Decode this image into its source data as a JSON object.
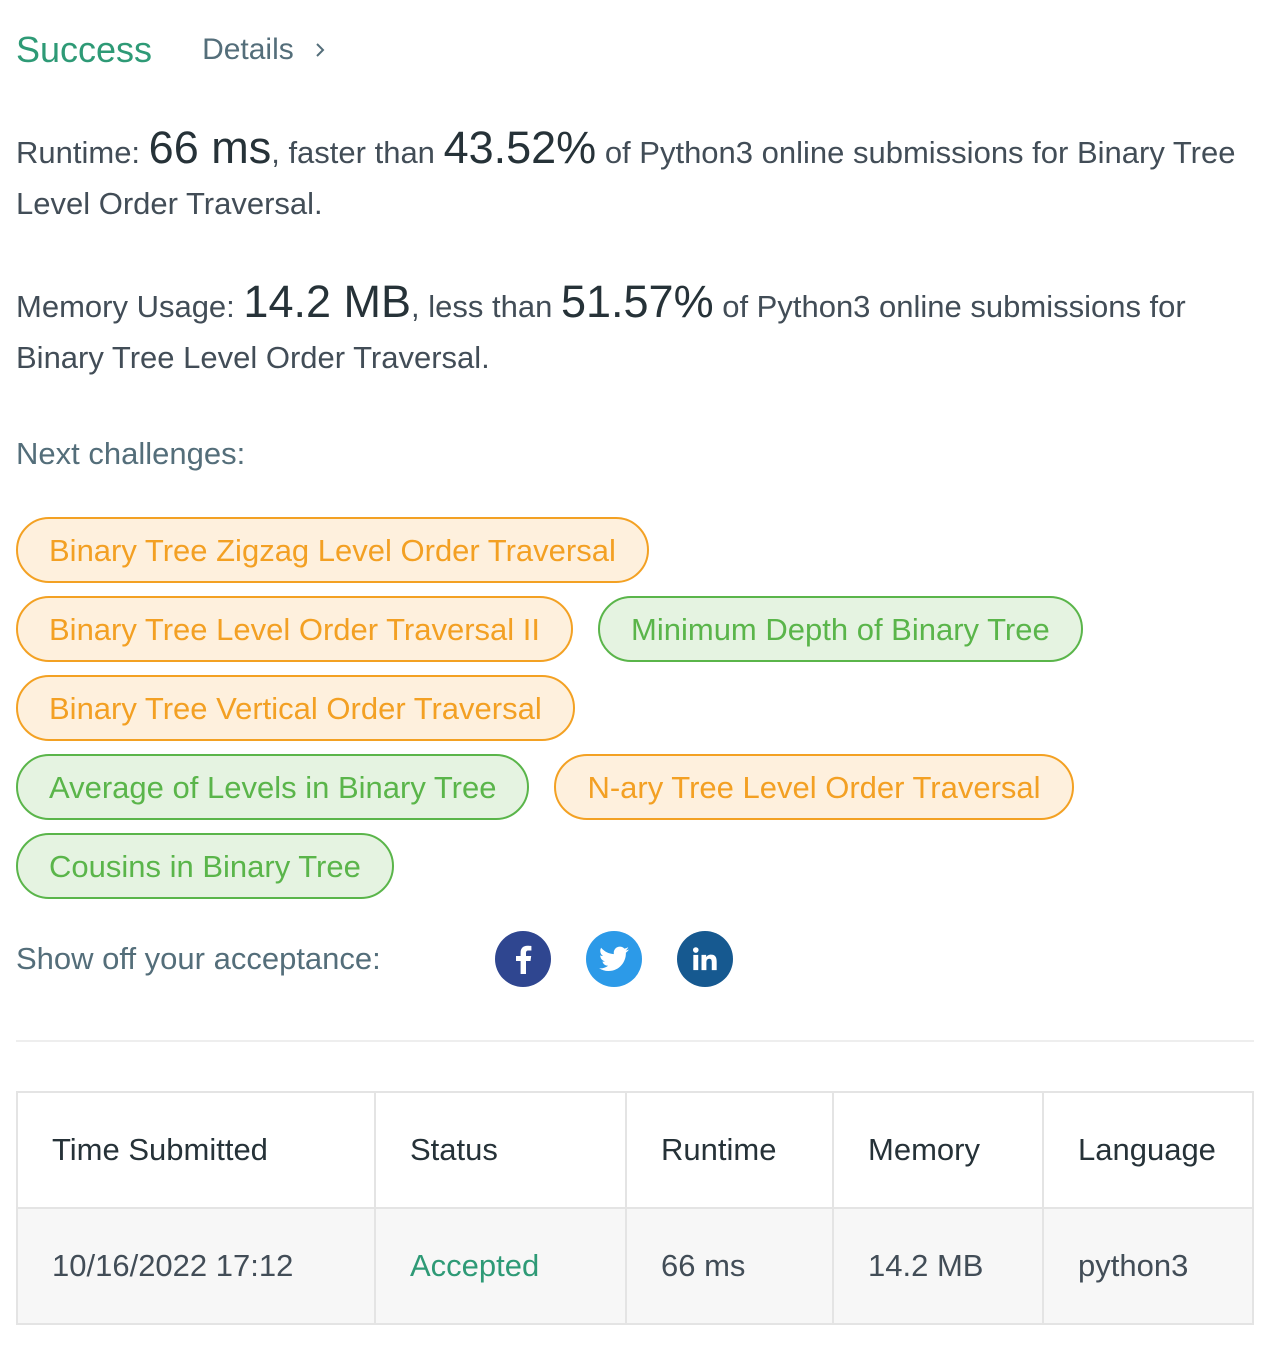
{
  "header": {
    "status": "Success",
    "details_label": "Details"
  },
  "runtime_stat": {
    "label": "Runtime:",
    "value": "66 ms",
    "mid_text": ", faster than",
    "percent": "43.52%",
    "tail_text": "of Python3 online submissions for Binary Tree Level Order Traversal."
  },
  "memory_stat": {
    "label": "Memory Usage:",
    "value": "14.2 MB",
    "mid_text": ", less than",
    "percent": "51.57%",
    "tail_text": "of Python3 online submissions for Binary Tree Level Order Traversal."
  },
  "next_challenges": {
    "label": "Next challenges:",
    "rows": [
      [
        {
          "title": "Binary Tree Zigzag Level Order Traversal",
          "difficulty": "medium"
        }
      ],
      [
        {
          "title": "Binary Tree Level Order Traversal II",
          "difficulty": "medium"
        },
        {
          "title": "Minimum Depth of Binary Tree",
          "difficulty": "easy"
        }
      ],
      [
        {
          "title": "Binary Tree Vertical Order Traversal",
          "difficulty": "medium"
        }
      ],
      [
        {
          "title": "Average of Levels in Binary Tree",
          "difficulty": "easy"
        },
        {
          "title": "N-ary Tree Level Order Traversal",
          "difficulty": "medium"
        }
      ],
      [
        {
          "title": "Cousins in Binary Tree",
          "difficulty": "easy"
        }
      ]
    ]
  },
  "share": {
    "label": "Show off your acceptance:",
    "icons": [
      "facebook-icon",
      "twitter-icon",
      "linkedin-icon"
    ]
  },
  "submissions": {
    "headers": [
      "Time Submitted",
      "Status",
      "Runtime",
      "Memory",
      "Language"
    ],
    "rows": [
      [
        "10/16/2022 17:12",
        "Accepted",
        "66 ms",
        "14.2 MB",
        "python3"
      ]
    ]
  },
  "colors": {
    "success_green": "#2e9a76",
    "medium_orange": "#f3a023",
    "easy_green": "#5ab54a",
    "facebook": "#2f4690",
    "twitter": "#2c9ae8",
    "linkedin": "#165990"
  }
}
